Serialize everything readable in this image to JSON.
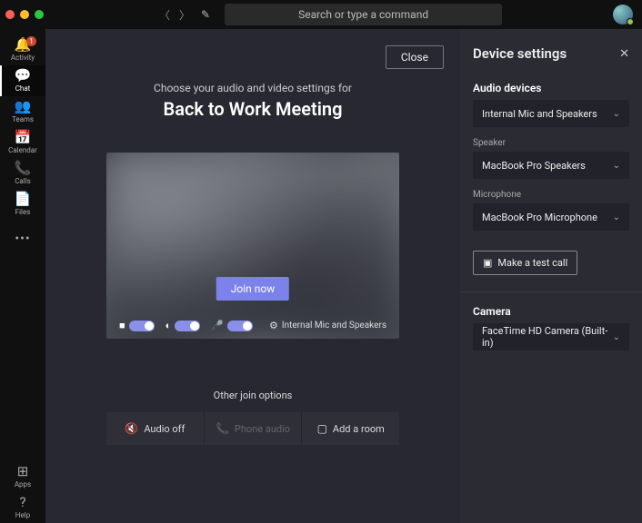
{
  "titlebar": {
    "search_placeholder": "Search or type a command"
  },
  "rail": {
    "items": [
      {
        "icon": "🔔",
        "label": "Activity",
        "badge": "1"
      },
      {
        "icon": "💬",
        "label": "Chat"
      },
      {
        "icon": "👥",
        "label": "Teams"
      },
      {
        "icon": "📅",
        "label": "Calendar"
      },
      {
        "icon": "📞",
        "label": "Calls"
      },
      {
        "icon": "📄",
        "label": "Files"
      }
    ],
    "more": "•••",
    "apps": {
      "icon": "⊞",
      "label": "Apps"
    },
    "help": {
      "icon": "?",
      "label": "Help"
    }
  },
  "prejoin": {
    "close": "Close",
    "subtitle": "Choose your audio and video settings for",
    "title": "Back to Work Meeting",
    "join": "Join now",
    "device_label": "Internal Mic and Speakers",
    "other_header": "Other join options",
    "options": [
      {
        "icon": "🔇",
        "label": "Audio off",
        "enabled": true
      },
      {
        "icon": "📞",
        "label": "Phone audio",
        "enabled": false
      },
      {
        "icon": "▢",
        "label": "Add a room",
        "enabled": true
      }
    ]
  },
  "panel": {
    "title": "Device settings",
    "audio_section": "Audio devices",
    "audio_profile": "Internal Mic and Speakers",
    "speaker_label": "Speaker",
    "speaker_value": "MacBook Pro Speakers",
    "mic_label": "Microphone",
    "mic_value": "MacBook Pro Microphone",
    "test_call": "Make a test call",
    "camera_section": "Camera",
    "camera_value": "FaceTime HD Camera (Built-in)"
  }
}
